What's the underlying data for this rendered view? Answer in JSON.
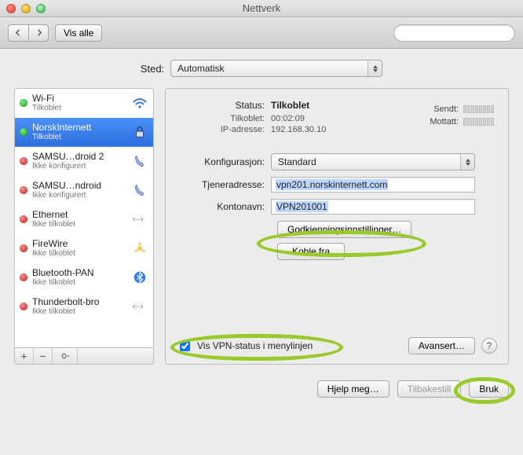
{
  "window": {
    "title": "Nettverk"
  },
  "toolbar": {
    "show_all": "Vis alle"
  },
  "location": {
    "label": "Sted:",
    "value": "Automatisk"
  },
  "sidebar": {
    "items": [
      {
        "name": "Wi-Fi",
        "sub": "Tilkoblet",
        "status": "green",
        "icon": "wifi"
      },
      {
        "name": "NorskInternett",
        "sub": "Tilkoblet",
        "status": "green",
        "icon": "lock",
        "selected": true
      },
      {
        "name": "SAMSU…droid 2",
        "sub": "Ikke konfigurert",
        "status": "red",
        "icon": "phone"
      },
      {
        "name": "SAMSU…ndroid",
        "sub": "Ikke konfigurert",
        "status": "red",
        "icon": "phone"
      },
      {
        "name": "Ethernet",
        "sub": "Ikke tilkoblet",
        "status": "red",
        "icon": "ethernet"
      },
      {
        "name": "FireWire",
        "sub": "Ikke tilkoblet",
        "status": "red",
        "icon": "firewire"
      },
      {
        "name": "Bluetooth-PAN",
        "sub": "Ikke tilkoblet",
        "status": "red",
        "icon": "bluetooth"
      },
      {
        "name": "Thunderbolt-bro",
        "sub": "Ikke tilkoblet",
        "status": "red",
        "icon": "ethernet"
      }
    ]
  },
  "details": {
    "status_label": "Status:",
    "status_value": "Tilkoblet",
    "connected_label": "Tilkoblet:",
    "connected_value": "00:02:09",
    "ip_label": "IP-adresse:",
    "ip_value": "192.168.30.10",
    "sent_label": "Sendt:",
    "recv_label": "Mottatt:",
    "config_label": "Konfigurasjon:",
    "config_value": "Standard",
    "server_label": "Tjeneradresse:",
    "server_value": "vpn201.norskinternett.com",
    "account_label": "Kontonavn:",
    "account_value": "VPN201001",
    "auth_button": "Godkjenningsinnstillinger…",
    "disconnect_button": "Koble fra",
    "show_vpn_label": "Vis VPN-status i menylinjen",
    "advanced_button": "Avansert…"
  },
  "footer": {
    "help": "Hjelp meg…",
    "revert": "Tilbakestill",
    "apply": "Bruk"
  }
}
